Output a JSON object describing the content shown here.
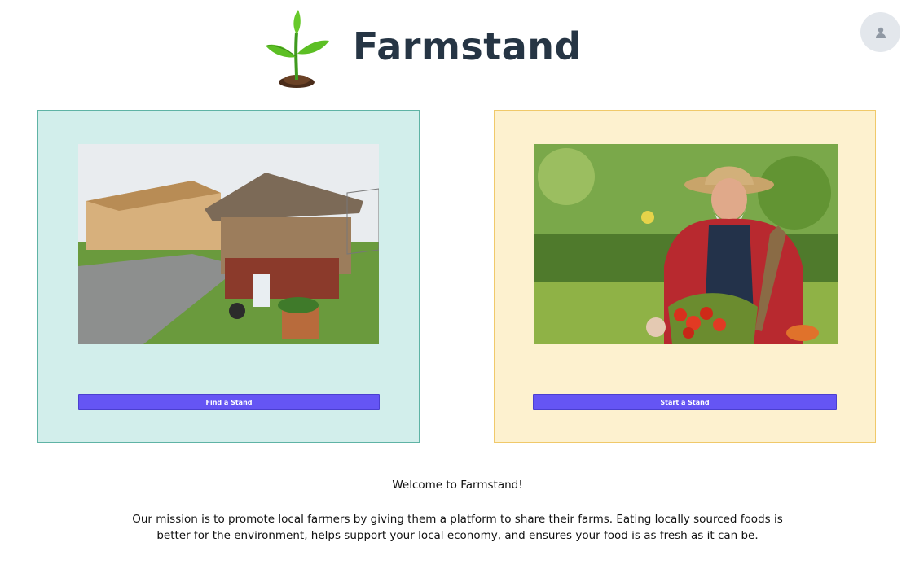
{
  "header": {
    "title": "Farmstand",
    "logo_icon": "sprout-logo-icon",
    "avatar_icon": "user-icon"
  },
  "cards": [
    {
      "id": "find",
      "image": "roadside-farm-stand-photo",
      "button_label": "Find a Stand",
      "background": "#d2eeeb",
      "border": "#5fb3a5"
    },
    {
      "id": "start",
      "image": "farmer-with-vegetables-photo",
      "button_label": "Start a Stand",
      "background": "#fdf1cf",
      "border": "#f0c96a"
    }
  ],
  "colors": {
    "button": "#6555f4",
    "title": "#263544"
  },
  "footer": {
    "welcome": "Welcome to Farmstand!",
    "mission": "Our mission is to promote local farmers by giving them a platform to share their farms. Eating locally sourced foods is better for the environment, helps support your local economy, and ensures your food is as fresh as it can be."
  }
}
